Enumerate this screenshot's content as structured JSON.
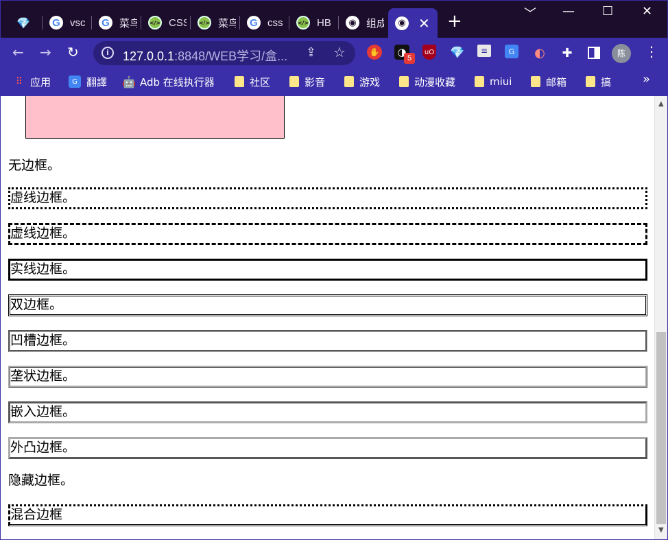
{
  "browser": {
    "tabs": [
      {
        "icon": "gem-icon",
        "title": ""
      },
      {
        "icon": "google-icon",
        "title": "vsc"
      },
      {
        "icon": "google-icon",
        "title": "菜鸟"
      },
      {
        "icon": "code-icon",
        "title": "CSS"
      },
      {
        "icon": "code-icon",
        "title": "菜鸟"
      },
      {
        "icon": "google-icon",
        "title": "css"
      },
      {
        "icon": "code-icon",
        "title": "HB"
      },
      {
        "icon": "globe-icon",
        "title": "组成"
      },
      {
        "icon": "globe-icon",
        "title": "",
        "active": true
      }
    ],
    "new_tab": "+",
    "window": {
      "chevron": "﹀",
      "minimize": "—",
      "maximize": "☐",
      "close": "✕"
    },
    "nav": {
      "back": "←",
      "forward": "→",
      "reload": "↻"
    },
    "address": {
      "host": "127.0.0.1",
      "rest": ":8848/WEB学习/盒..."
    },
    "extensions": {
      "badge_count": "5",
      "avatar": "陈"
    },
    "bookmarks": [
      {
        "icon": "apps",
        "label": "应用"
      },
      {
        "icon": "translate",
        "label": "翻譯"
      },
      {
        "icon": "android",
        "label": "Adb 在线执行器"
      },
      {
        "icon": "folder",
        "label": "社区"
      },
      {
        "icon": "folder",
        "label": "影音"
      },
      {
        "icon": "folder",
        "label": "游戏"
      },
      {
        "icon": "folder",
        "label": "动漫收藏"
      },
      {
        "icon": "folder",
        "label": "miui"
      },
      {
        "icon": "folder",
        "label": "邮箱"
      },
      {
        "icon": "folder",
        "label": "搞"
      }
    ],
    "bookmarks_more": "»"
  },
  "page": {
    "paragraphs": [
      {
        "style": "none",
        "text": "无边框。"
      },
      {
        "style": "dotted",
        "text": "虚线边框。"
      },
      {
        "style": "dashed",
        "text": "虚线边框。"
      },
      {
        "style": "solid",
        "text": "实线边框。"
      },
      {
        "style": "double",
        "text": "双边框。"
      },
      {
        "style": "groove",
        "text": "凹槽边框。"
      },
      {
        "style": "ridge",
        "text": "垄状边框。"
      },
      {
        "style": "inset",
        "text": "嵌入边框。"
      },
      {
        "style": "outset",
        "text": "外凸边框。"
      },
      {
        "style": "hidden",
        "text": "隐藏边框。"
      },
      {
        "style": "mixed",
        "text": "混合边框"
      }
    ]
  }
}
